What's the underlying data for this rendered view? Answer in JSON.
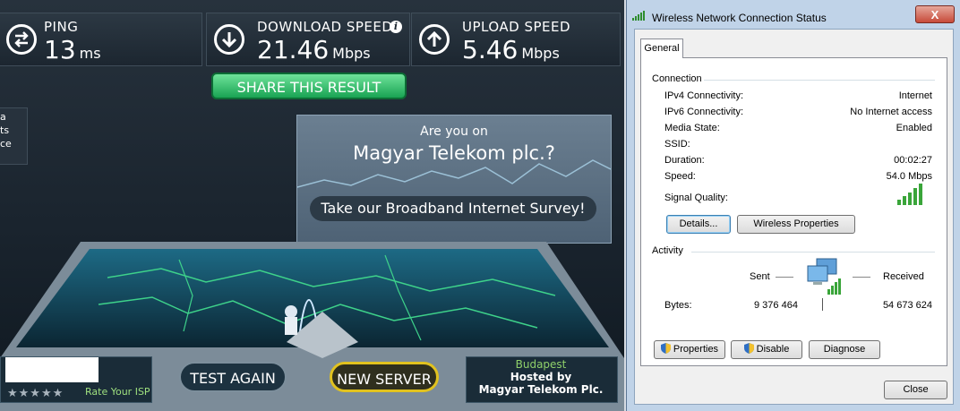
{
  "speedtest": {
    "ping": {
      "label": "PING",
      "value": "13",
      "unit": "ms"
    },
    "download": {
      "label": "DOWNLOAD SPEED",
      "value": "21.46",
      "unit": "Mbps",
      "info": "i"
    },
    "upload": {
      "label": "UPLOAD SPEED",
      "value": "5.46",
      "unit": "Mbps"
    },
    "share_label": "SHARE THIS RESULT",
    "side_note": [
      "a",
      "ts",
      "ce"
    ],
    "survey": {
      "question": "Are you on",
      "isp": "Magyar Telekom plc.?",
      "cta": "Take our Broadband Internet Survey!"
    },
    "rate_isp": "Rate Your ISP",
    "stars": "★★★★★",
    "test_again": "TEST AGAIN",
    "new_server": "NEW SERVER",
    "location": {
      "city": "Budapest",
      "hosted_by": "Hosted by",
      "host": "Magyar Telekom Plc."
    },
    "colors": {
      "accent_green": "#19a353",
      "new_server_border": "#e1c21f",
      "rate_green": "#9fe07f"
    }
  },
  "dialog": {
    "title": "Wireless Network Connection Status",
    "close_glyph": "X",
    "tab": "General",
    "connection": {
      "heading": "Connection",
      "rows": [
        {
          "label": "IPv4 Connectivity:",
          "value": "Internet"
        },
        {
          "label": "IPv6 Connectivity:",
          "value": "No Internet access"
        },
        {
          "label": "Media State:",
          "value": "Enabled"
        },
        {
          "label": "SSID:",
          "value": ""
        },
        {
          "label": "Duration:",
          "value": "00:02:27"
        },
        {
          "label": "Speed:",
          "value": "54.0 Mbps"
        }
      ],
      "signal_label": "Signal Quality:",
      "signal_bars": 5,
      "details_button": "Details...",
      "wireless_properties_button": "Wireless Properties"
    },
    "activity": {
      "heading": "Activity",
      "sent_label": "Sent",
      "received_label": "Received",
      "bytes_label": "Bytes:",
      "sent_bytes": "9 376 464",
      "received_bytes": "54 673 624"
    },
    "properties_button": "Properties",
    "disable_button": "Disable",
    "diagnose_button": "Diagnose",
    "close_button": "Close"
  }
}
